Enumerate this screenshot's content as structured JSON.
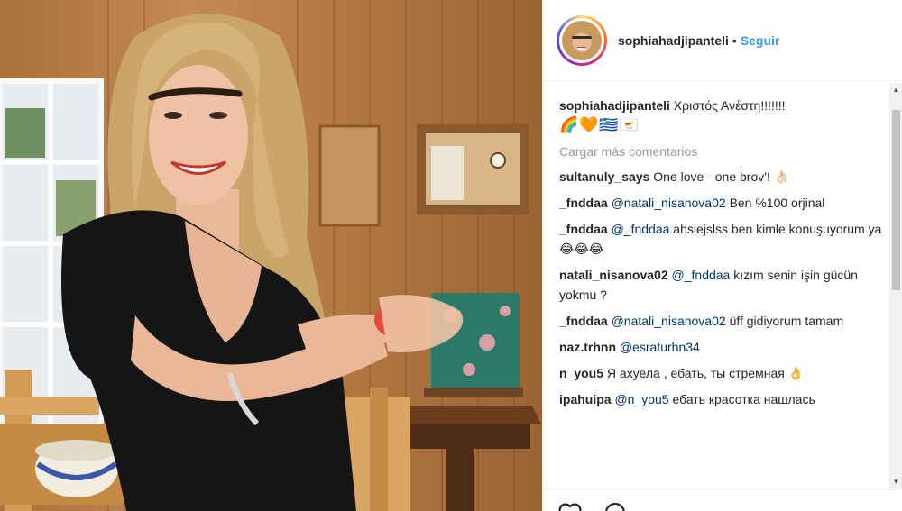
{
  "header": {
    "username": "sophiahadjipanteli",
    "separator": "•",
    "follow_label": "Seguir"
  },
  "caption": {
    "username": "sophiahadjipanteli",
    "text": "Χριστός Ανέστη!!!!!!!",
    "emojis": "🌈🧡🇬🇷🇨🇾"
  },
  "load_more_label": "Cargar más comentarios",
  "comments": [
    {
      "user": "sultanuly_says",
      "mention": "",
      "text": "One love - one brov'! 👌🏻"
    },
    {
      "user": "_fnddaa",
      "mention": "@natali_nisanova02",
      "text": "Ben %100 orjinal"
    },
    {
      "user": "_fnddaa",
      "mention": "@_fnddaa",
      "text": "ahslejslss ben kimle konuşuyorum ya 😂😂😂"
    },
    {
      "user": "natali_nisanova02",
      "mention": "@_fnddaa",
      "text": "kızım senin işin gücün yokmu ?"
    },
    {
      "user": "_fnddaa",
      "mention": "@natali_nisanova02",
      "text": "üff gidiyorum tamam"
    },
    {
      "user": "naz.trhnn",
      "mention": "@esraturhn34",
      "text": ""
    },
    {
      "user": "n_you5",
      "mention": "",
      "text": "Я ахуела , ебать, ты стремная 👌"
    },
    {
      "user": "ipahuipa",
      "mention": "@n_you5",
      "text": "ебать красотка нашлась"
    }
  ],
  "icons": {
    "like": "heart-icon",
    "comment": "comment-icon",
    "scroll_up": "triangle-up",
    "scroll_down": "triangle-down"
  },
  "colors": {
    "link_blue": "#3897f0",
    "mention_blue": "#003569",
    "muted_gray": "#999999"
  }
}
